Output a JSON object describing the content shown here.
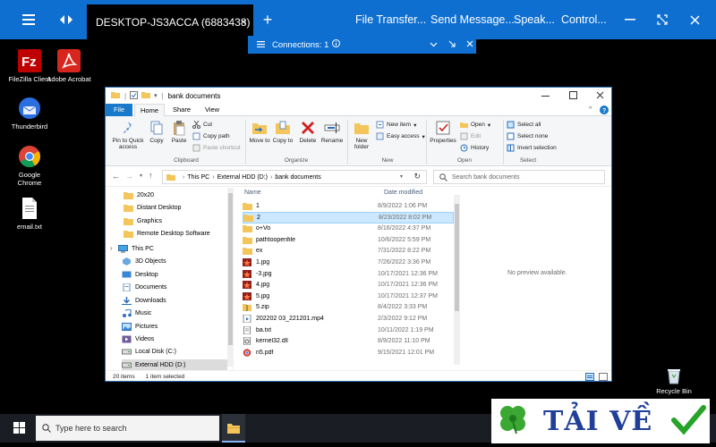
{
  "tv": {
    "tab_title": "DESKTOP-JS3ACCA (6883438)",
    "tab_close": "×",
    "add_tab": "+",
    "menu": [
      "File Transfer...",
      "Send Message...",
      "Speak...",
      "Control..."
    ],
    "connections_label": "Connections: 1"
  },
  "desktop": {
    "icons": [
      "FileZilla Client",
      "Adobe Acrobat",
      "Thunderbird",
      "Google Chrome",
      "email.txt"
    ],
    "recycle": "Recycle Bin"
  },
  "explorer": {
    "title": "bank documents",
    "tabs": [
      "File",
      "Home",
      "Share",
      "View"
    ],
    "ribbon": {
      "pin": "Pin to Quick access",
      "copy": "Copy",
      "paste": "Paste",
      "cut": "Cut",
      "copy_path": "Copy path",
      "paste_shortcut": "Paste shortcut",
      "move_to": "Move to",
      "copy_to": "Copy to",
      "delete": "Delete",
      "rename": "Rename",
      "new_folder": "New folder",
      "new_item": "New item",
      "easy_access": "Easy access",
      "properties": "Properties",
      "open": "Open",
      "edit": "Edit",
      "history": "History",
      "select_all": "Select all",
      "select_none": "Select none",
      "invert_selection": "Invert selection",
      "groups": [
        "Clipboard",
        "Organize",
        "New",
        "Open",
        "Select"
      ]
    },
    "address": {
      "crumbs": [
        "This PC",
        "External HDD (D:)",
        "bank documents"
      ],
      "search_placeholder": "Search bank documents"
    },
    "nav": [
      {
        "label": "20x20",
        "type": "folder"
      },
      {
        "label": "Distant Desktop",
        "type": "folder"
      },
      {
        "label": "Graphics",
        "type": "folder"
      },
      {
        "label": "Remote Desktop Software",
        "type": "folder"
      },
      {
        "label": "This PC",
        "type": "pc"
      },
      {
        "label": "3D Objects",
        "type": "obj3d"
      },
      {
        "label": "Desktop",
        "type": "desktop"
      },
      {
        "label": "Documents",
        "type": "docs"
      },
      {
        "label": "Downloads",
        "type": "down"
      },
      {
        "label": "Music",
        "type": "music"
      },
      {
        "label": "Pictures",
        "type": "pics"
      },
      {
        "label": "Videos",
        "type": "videos"
      },
      {
        "label": "Local Disk (C:)",
        "type": "disk"
      },
      {
        "label": "External HDD (D:)",
        "type": "disk"
      }
    ],
    "columns": {
      "name": "Name",
      "date": "Date modified"
    },
    "files": [
      {
        "name": "1",
        "date": "8/9/2022 1:06 PM",
        "type": "folder"
      },
      {
        "name": "2",
        "date": "8/23/2022 8:02 PM",
        "type": "folder"
      },
      {
        "name": "o+Vo",
        "date": "8/16/2022 4:37 PM",
        "type": "folder"
      },
      {
        "name": "pathtoopenfile",
        "date": "10/6/2022 5:59 PM",
        "type": "folder"
      },
      {
        "name": "ex",
        "date": "7/31/2022 8:22 PM",
        "type": "folder"
      },
      {
        "name": "1.jpg",
        "date": "7/26/2022 3:36 PM",
        "type": "jpg"
      },
      {
        "name": "-3.jpg",
        "date": "10/17/2021 12:36 PM",
        "type": "jpg"
      },
      {
        "name": "4.jpg",
        "date": "10/17/2021 12:36 PM",
        "type": "jpg"
      },
      {
        "name": "5.jpg",
        "date": "10/17/2021 12:37 PM",
        "type": "jpg"
      },
      {
        "name": "5.zip",
        "date": "8/4/2022 3:33 PM",
        "type": "zip"
      },
      {
        "name": "202202 03_221201.mp4",
        "date": "2/3/2022 9:12 PM",
        "type": "mp4"
      },
      {
        "name": "ba.txt",
        "date": "10/11/2022 1:19 PM",
        "type": "txt"
      },
      {
        "name": "kernel32.dll",
        "date": "8/9/2022 11:10 PM",
        "type": "dll"
      },
      {
        "name": "n5.pdf",
        "date": "9/15/2021 12:01 PM",
        "type": "pdf"
      }
    ],
    "preview_text": "No preview available.",
    "status": {
      "items": "20 items",
      "selected": "1 item selected"
    }
  },
  "taskbar": {
    "search_placeholder": "Type here to search"
  },
  "watermark": {
    "text": "TẢI VỀ"
  },
  "colors": {
    "tv_blue": "#0e6fd1",
    "folder_yellow": "#f4c55a",
    "selected_row": "#cce8ff",
    "ribbon_file_tab": "#1979ca"
  }
}
